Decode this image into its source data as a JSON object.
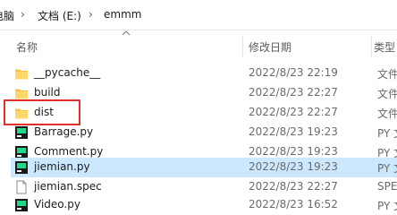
{
  "breadcrumb": {
    "items": [
      "电脑",
      "文档 (E:)",
      "emmm"
    ]
  },
  "columns": {
    "name": "名称",
    "date": "修改日期",
    "type": "类型"
  },
  "files": [
    {
      "name": "__pycache__",
      "date": "2022/8/23 22:19",
      "type": "文件",
      "icon": "folder-icon"
    },
    {
      "name": "build",
      "date": "2022/8/23 22:27",
      "type": "文件",
      "icon": "folder-icon"
    },
    {
      "name": "dist",
      "date": "2022/8/23 22:27",
      "type": "文件",
      "icon": "folder-icon"
    },
    {
      "name": "Barrage.py",
      "date": "2022/8/23 19:23",
      "type": "PY 文",
      "icon": "python-file-icon"
    },
    {
      "name": "Comment.py",
      "date": "2022/8/23 19:23",
      "type": "PY 文",
      "icon": "python-file-icon"
    },
    {
      "name": "jiemian.py",
      "date": "2022/8/23 19:23",
      "type": "PY 文",
      "icon": "python-file-icon"
    },
    {
      "name": "jiemian.spec",
      "date": "2022/8/23 22:27",
      "type": "SPE",
      "icon": "document-icon"
    },
    {
      "name": "Video.py",
      "date": "2022/8/23 16:52",
      "type": "PY 文",
      "icon": "python-file-icon"
    }
  ],
  "selected_file": "jiemian.py",
  "highlighted_file": "dist",
  "colors": {
    "selection": "#cce8ff",
    "highlight_border": "#e0302b",
    "folder": "#f5c443"
  }
}
